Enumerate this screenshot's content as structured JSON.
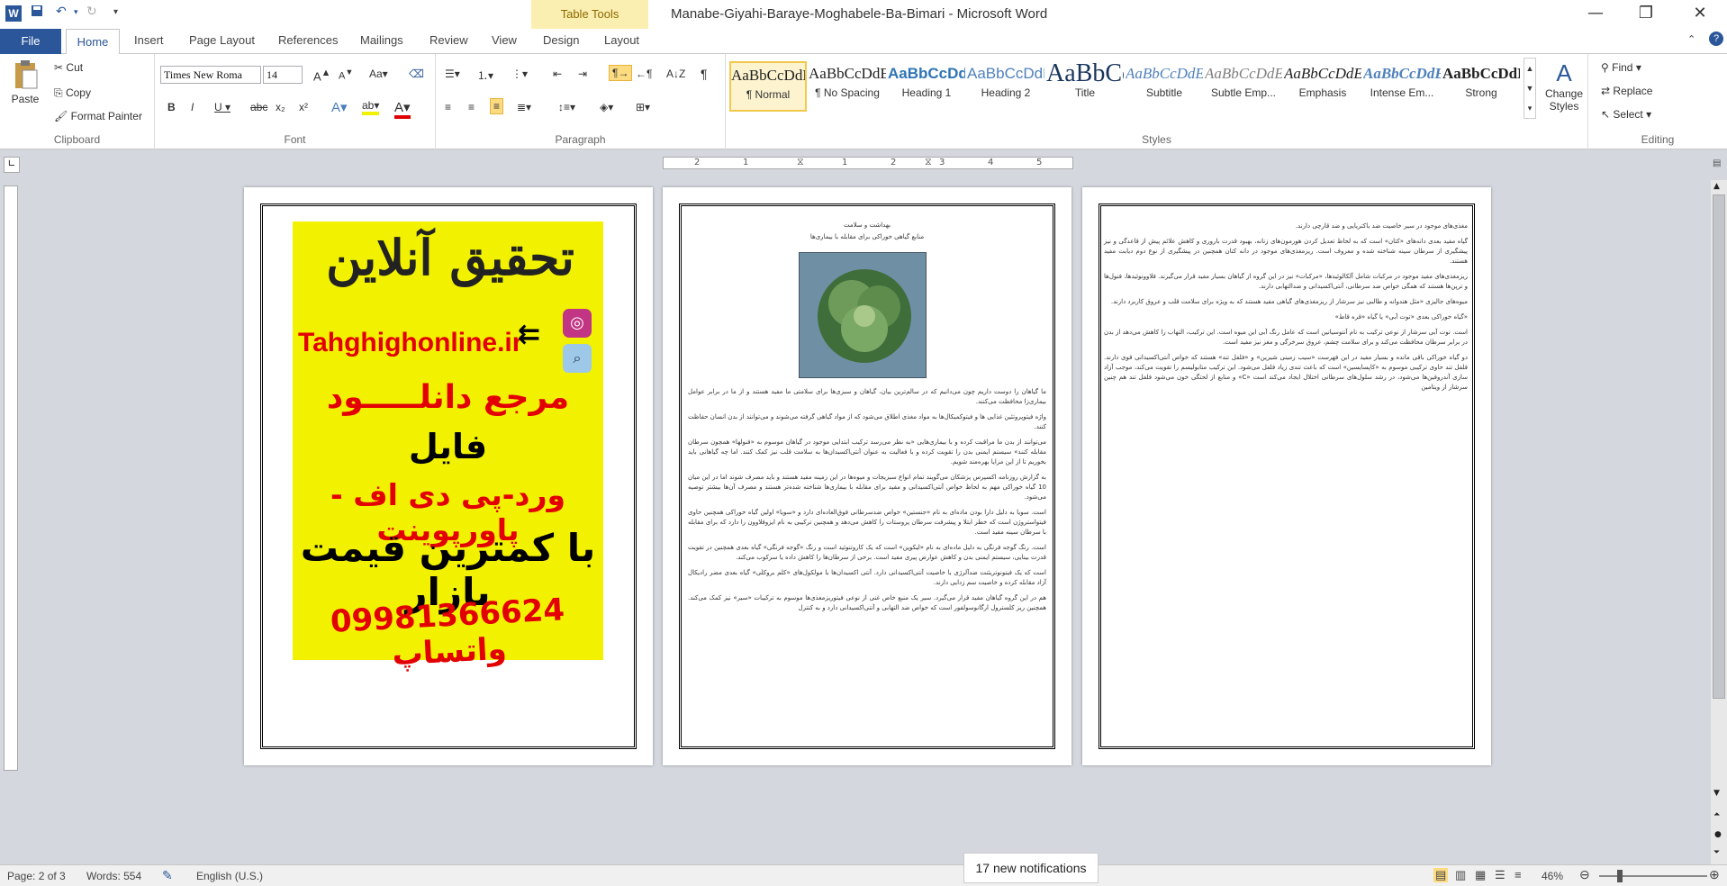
{
  "window": {
    "title": "Manabe-Giyahi-Baraye-Moghabele-Ba-Bimari  -  Microsoft Word",
    "contextual_tab_group": "Table Tools",
    "app_letter": "W"
  },
  "tabs": [
    "File",
    "Home",
    "Insert",
    "Page Layout",
    "References",
    "Mailings",
    "Review",
    "View",
    "Design",
    "Layout"
  ],
  "clipboard": {
    "paste": "Paste",
    "cut": "Cut",
    "copy": "Copy",
    "format_painter": "Format Painter",
    "label": "Clipboard"
  },
  "font": {
    "name": "Times New Roma",
    "size": "14",
    "label": "Font"
  },
  "paragraph": {
    "label": "Paragraph"
  },
  "styles": {
    "items": [
      {
        "preview": "AaBbCcDdEe",
        "name": "¶ Normal"
      },
      {
        "preview": "AaBbCcDdEe",
        "name": "¶ No Spacing"
      },
      {
        "preview": "AaBbCcDdEe",
        "name": "Heading 1"
      },
      {
        "preview": "AaBbCcDdEe",
        "name": "Heading 2"
      },
      {
        "preview": "AaBbCcDdEe",
        "name": "Title"
      },
      {
        "preview": "AaBbCcDdEe",
        "name": "Subtitle"
      },
      {
        "preview": "AaBbCcDdEe",
        "name": "Subtle Emp..."
      },
      {
        "preview": "AaBbCcDdEe",
        "name": "Emphasis"
      },
      {
        "preview": "AaBbCcDdEe",
        "name": "Intense Em..."
      },
      {
        "preview": "AaBbCcDdEe",
        "name": "Strong"
      }
    ],
    "change": "Change Styles",
    "label": "Styles"
  },
  "editing": {
    "find": "Find",
    "replace": "Replace",
    "select": "Select",
    "label": "Editing"
  },
  "ruler": {
    "ticks": [
      "2",
      "1",
      "1",
      "2",
      "3",
      "4",
      "5"
    ]
  },
  "ad": {
    "title": "تحقیق آنلاین",
    "site": "Tahghighonline.ir",
    "line1": "مرجع دانلـــــود",
    "line2": "فایل",
    "line3": "ورد-پی دی اف - پاورپوینت",
    "line4": "با کمترین قیمت بازار",
    "phone": "09981366624",
    "whatsapp": "واتساپ"
  },
  "page2": {
    "heading1": "بهداشت و سلامت",
    "heading2": "منابع گیاهی خوراکی برای مقابله با بیماری‌ها",
    "paras": [
      "ما گیاهان را دوست داریم چون می‌دانیم که در سالم‌ترین بیان، گیاهان و سبزی‌ها برای سلامتی ما مفید هستند و از ما در برابر عوامل بیماری‌زا محافظت می‌کنند.",
      "واژه فیتوپروتئین غذایی ها و فیتوکمیکال‌ها به مواد مغذی اطلاق می‌شود که از مواد گیاهی گرفته می‌شوند و می‌توانند از بدن انسان حفاظت کنند.",
      "می‌توانند از بدن ما مراقبت کرده و با بیماری‌هایی «به نظر می‌رسد ترکیب ابتدایی موجود در گیاهان موسوم به «فنولها» همچون سرطان مقابله کنند» سیستم ایمنی بدن را تقویت کرده و با فعالیت به عنوان آنتی‌اکسیدان‌ها به سلامت قلب نیز کمک کنند. اما چه گیاهانی باید بخوریم تا از این مزایا بهره‌مند شویم.",
      "به گزارش روزنامه اکسپرس پزشکان می‌گویند تمام انواع سبزیجات و میوه‌ها در این زمینه مفید هستند و باید مصرف شوند اما در این میان 10 گیاه خوراکی مهم به لحاظ خواص آنتی‌اکسیدانی و مفید برای مقابله با بیماری‌ها شناخته شده‌تر هستند و مصرف آن‌ها بیشتر توصیه می‌شود.",
      "است. سویا به دلیل دارا بودن ماده‌ای به نام «جنستین» خواص ضدسرطانی فوق‌العاده‌ای دارد و «سویا» اولین گیاه خوراکی همچنین حاوی فیتواستروژن است که خطر ابتلا و پیشرفت سرطان پروستات را کاهش می‌دهد و همچنین ترکیبی به نام ایزوفلاوون را دارد که برای مقابله با سرطان سینه مفید است.",
      "است. رنگ گوجه فرنگی به دلیل ماده‌ای به نام «لیکوپن» است که یک کاروتنوئید است و رنگ «گوجه فرنگی» گیاه بعدی همچنین در تقویت قدرت بینایی، سیستم ایمنی بدن و کاهش عوارض پیری مفید است. برخی از سرطان‌ها را کاهش داده یا سرکوب می‌کند.",
      "است که یک فیتونوتریئنت ضدآلرژی با خاصیت آنتی‌اکسیدانی دارد. آنتی اکسیدان‌ها با مولکول‌های «کلم بروکلی» گیاه بعدی مضر رادیکال آزاد مقابله کرده و خاصیت سم زدایی دارند.",
      "هم در این گروه گیاهان مفید قرار می‌گیرد. سیر یک منبع خاص غنی از نوعی فیتوریزمغذی‌ها موسوم به ترکیبات «سیر» نیز کمک می‌کند. همچنین ریز کلسترول ارگانوسولفور است که خواص ضد التهابی و آنتی‌اکسیدانی دارد و به کنترل"
    ]
  },
  "page3": {
    "paras": [
      "مغذی‌های موجود در سیر خاصیت ضد باکتریایی و ضد قارچی دارند.",
      "گیاه مفید بعدی دانه‌های «کتان» است که به لحاظ تعدیل کردن هورمون‌های زنانه، بهبود قدرت باروری و کاهش علائم پیش از قاعدگی و نیز پیشگیری از سرطان سینه شناخته شده و معروف است. ریزمغذی‌های موجود در دانه کتان همچنین در پیشگیری از نوع دوم دیابت مفید هستند.",
      "ریزمغذی‌های مفید موجود در مرکبات شامل آلکالوئیدها، «مرکبات» نیز در این گروه از گیاهان بسیار مفید قرار می‌گیرند. فلاوونوئیدها، فنول‌ها و ترپن‌ها هستند که همگی خواص ضد سرطانی، آنتی‌اکسیدانی و ضدالتهابی دارند.",
      "میوه‌های جالیزی «مثل هندوانه و طالبی نیز سرشار از ریزمغذی‌های گیاهی مفید هستند که به ویژه برای سلامت قلب و عروق کاربرد دارند.",
      "«گیاه خوراکی بعدی «توت آبی» یا گیاه «قره قاط»",
      "است. توت آبی سرشار از نوعی ترکیب به نام آنتوسیانین است که عامل رنگ آبی این میوه است. این ترکیب، التهاب را کاهش می‌دهد از بدن در برابر سرطان محافظت می‌کند و برای سلامت چشم، عروق سرخرگی و مغز نیز مفید است.",
      "دو گیاه خوراکی باقی مانده و بسیار مفید در این فهرست «سیب زمینی شیرین» و «فلفل تند» هستند که خواص آنتی‌اکسیدانی قوی دارند. فلفل تند حاوی ترکیبی موسوم به «کاپسایسین» است که باعث تندی زیاد فلفل می‌شود. این ترکیب متابولیسم را تقویت می‌کند، موجب آزاد سازی آندروفین‌ها می‌شود، در رشد سلول‌های سرطانی اختلال ایجاد می‌کند است «C» و منابع از لحتگی خون می‌شود فلفل تند هم چنین سرشار از ویتامین"
    ]
  },
  "status": {
    "page": "Page: 2 of 3",
    "words": "Words: 554",
    "lang": "English (U.S.)",
    "zoom": "46%",
    "notif": "17 new notifications"
  }
}
